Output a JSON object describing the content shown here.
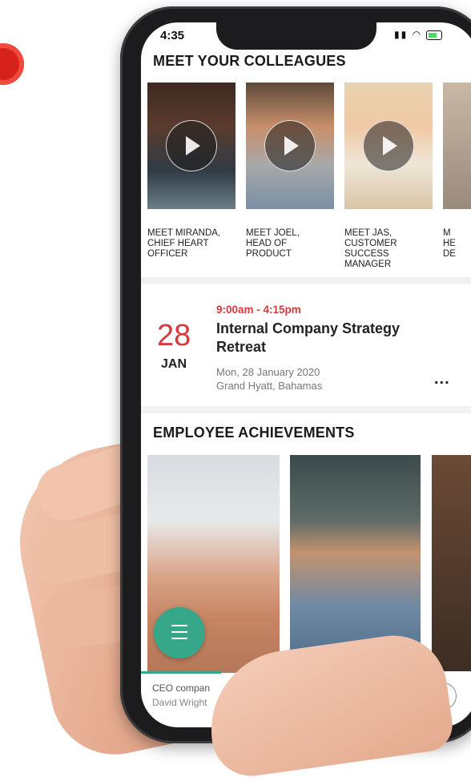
{
  "status_bar": {
    "time": "4:35"
  },
  "colleagues": {
    "title": "MEET YOUR COLLEAGUES",
    "items": [
      {
        "caption": "MEET MIRANDA, CHIEF HEART OFFICER"
      },
      {
        "caption": "MEET JOEL, HEAD OF PRODUCT"
      },
      {
        "caption": "MEET JAS, CUSTOMER SUCCESS MANAGER"
      },
      {
        "caption": "M HE DE"
      }
    ]
  },
  "event": {
    "day": "28",
    "month": "JAN",
    "time": "9:00am - 4:15pm",
    "title": "Internal Company Strategy Retreat",
    "date": "Mon, 28 January 2020",
    "location": "Grand Hyatt, Bahamas",
    "more": "..."
  },
  "achievements": {
    "title": "EMPLOYEE ACHIEVEMENTS",
    "caption1": "CEO compan",
    "caption2": "David Wright"
  },
  "colors": {
    "accent_red": "#d63a3a",
    "accent_green": "#36a889"
  }
}
